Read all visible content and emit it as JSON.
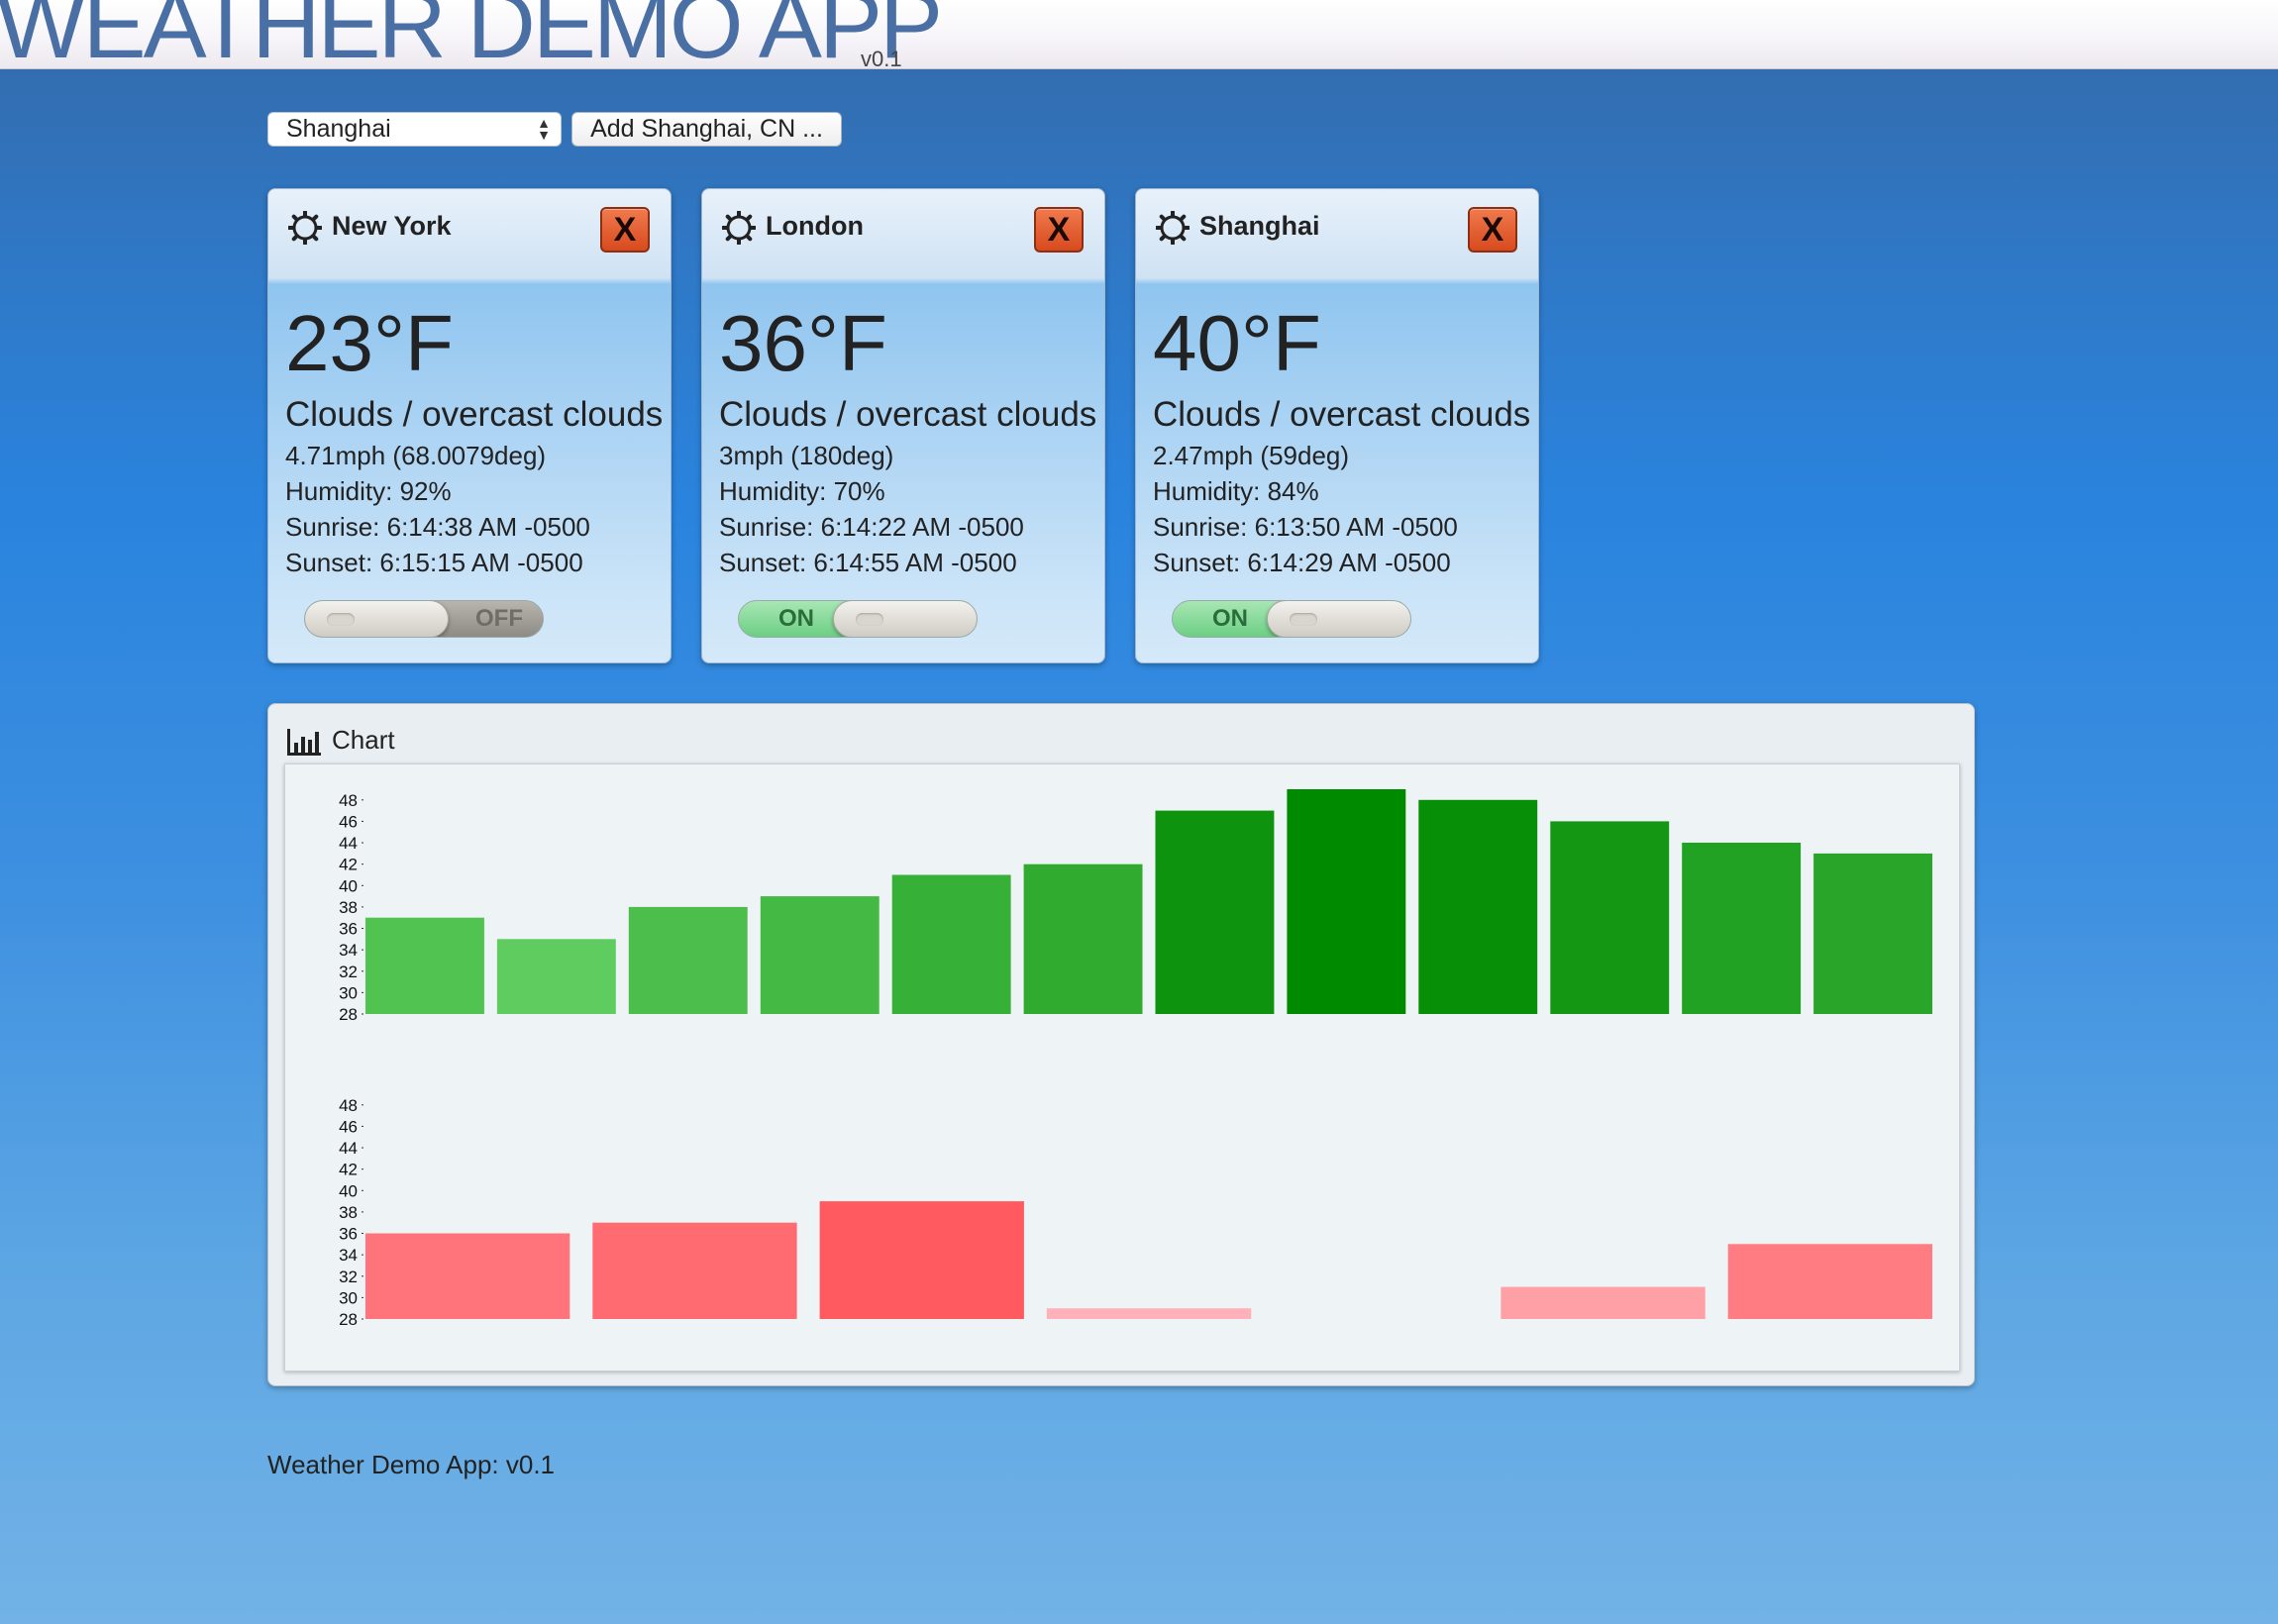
{
  "app": {
    "title": "WEATHER DEMO APP",
    "version": "v0.1"
  },
  "controls": {
    "city_select_value": "Shanghai",
    "add_button_label": "Add Shanghai, CN ..."
  },
  "cards": [
    {
      "city": "New York",
      "close_label": "X",
      "temperature": "23°F",
      "condition": "Clouds / overcast clouds",
      "wind": "4.71mph (68.0079deg)",
      "humidity": "Humidity: 92%",
      "sunrise": "Sunrise: 6:14:38 AM -0500",
      "sunset": "Sunset: 6:15:15 AM -0500",
      "toggle_label": "OFF",
      "toggle_state": "off",
      "icon": "gear-icon"
    },
    {
      "city": "London",
      "close_label": "X",
      "temperature": "36°F",
      "condition": "Clouds / overcast clouds",
      "wind": "3mph (180deg)",
      "humidity": "Humidity: 70%",
      "sunrise": "Sunrise: 6:14:22 AM -0500",
      "sunset": "Sunset: 6:14:55 AM -0500",
      "toggle_label": "ON",
      "toggle_state": "on",
      "icon": "gear-icon"
    },
    {
      "city": "Shanghai",
      "close_label": "X",
      "temperature": "40°F",
      "condition": "Clouds / overcast clouds",
      "wind": "2.47mph (59deg)",
      "humidity": "Humidity: 84%",
      "sunrise": "Sunrise: 6:13:50 AM -0500",
      "sunset": "Sunset: 6:14:29 AM -0500",
      "toggle_label": "ON",
      "toggle_state": "on",
      "icon": "gear-icon"
    }
  ],
  "chart_panel": {
    "label": "Chart",
    "icon": "bar-chart-icon"
  },
  "chart_data": [
    {
      "type": "bar",
      "y_ticks": [
        48,
        46,
        44,
        42,
        40,
        38,
        36,
        34,
        32,
        30,
        28
      ],
      "ylim": [
        28,
        49
      ],
      "values": [
        37,
        35,
        38,
        39,
        41,
        42,
        47,
        49,
        48,
        46,
        44,
        43
      ],
      "color_scale": [
        "#5fcc5f",
        "#008a00"
      ]
    },
    {
      "type": "bar",
      "y_ticks": [
        48,
        46,
        44,
        42,
        40,
        38,
        36,
        34,
        32,
        30,
        28
      ],
      "ylim": [
        28,
        49
      ],
      "values": [
        36,
        37,
        39,
        29,
        null,
        31,
        35
      ],
      "color_scale": [
        "#ffb0b8",
        "#ff5a5f"
      ]
    }
  ],
  "footer": {
    "text": "Weather Demo App: v0.1"
  }
}
